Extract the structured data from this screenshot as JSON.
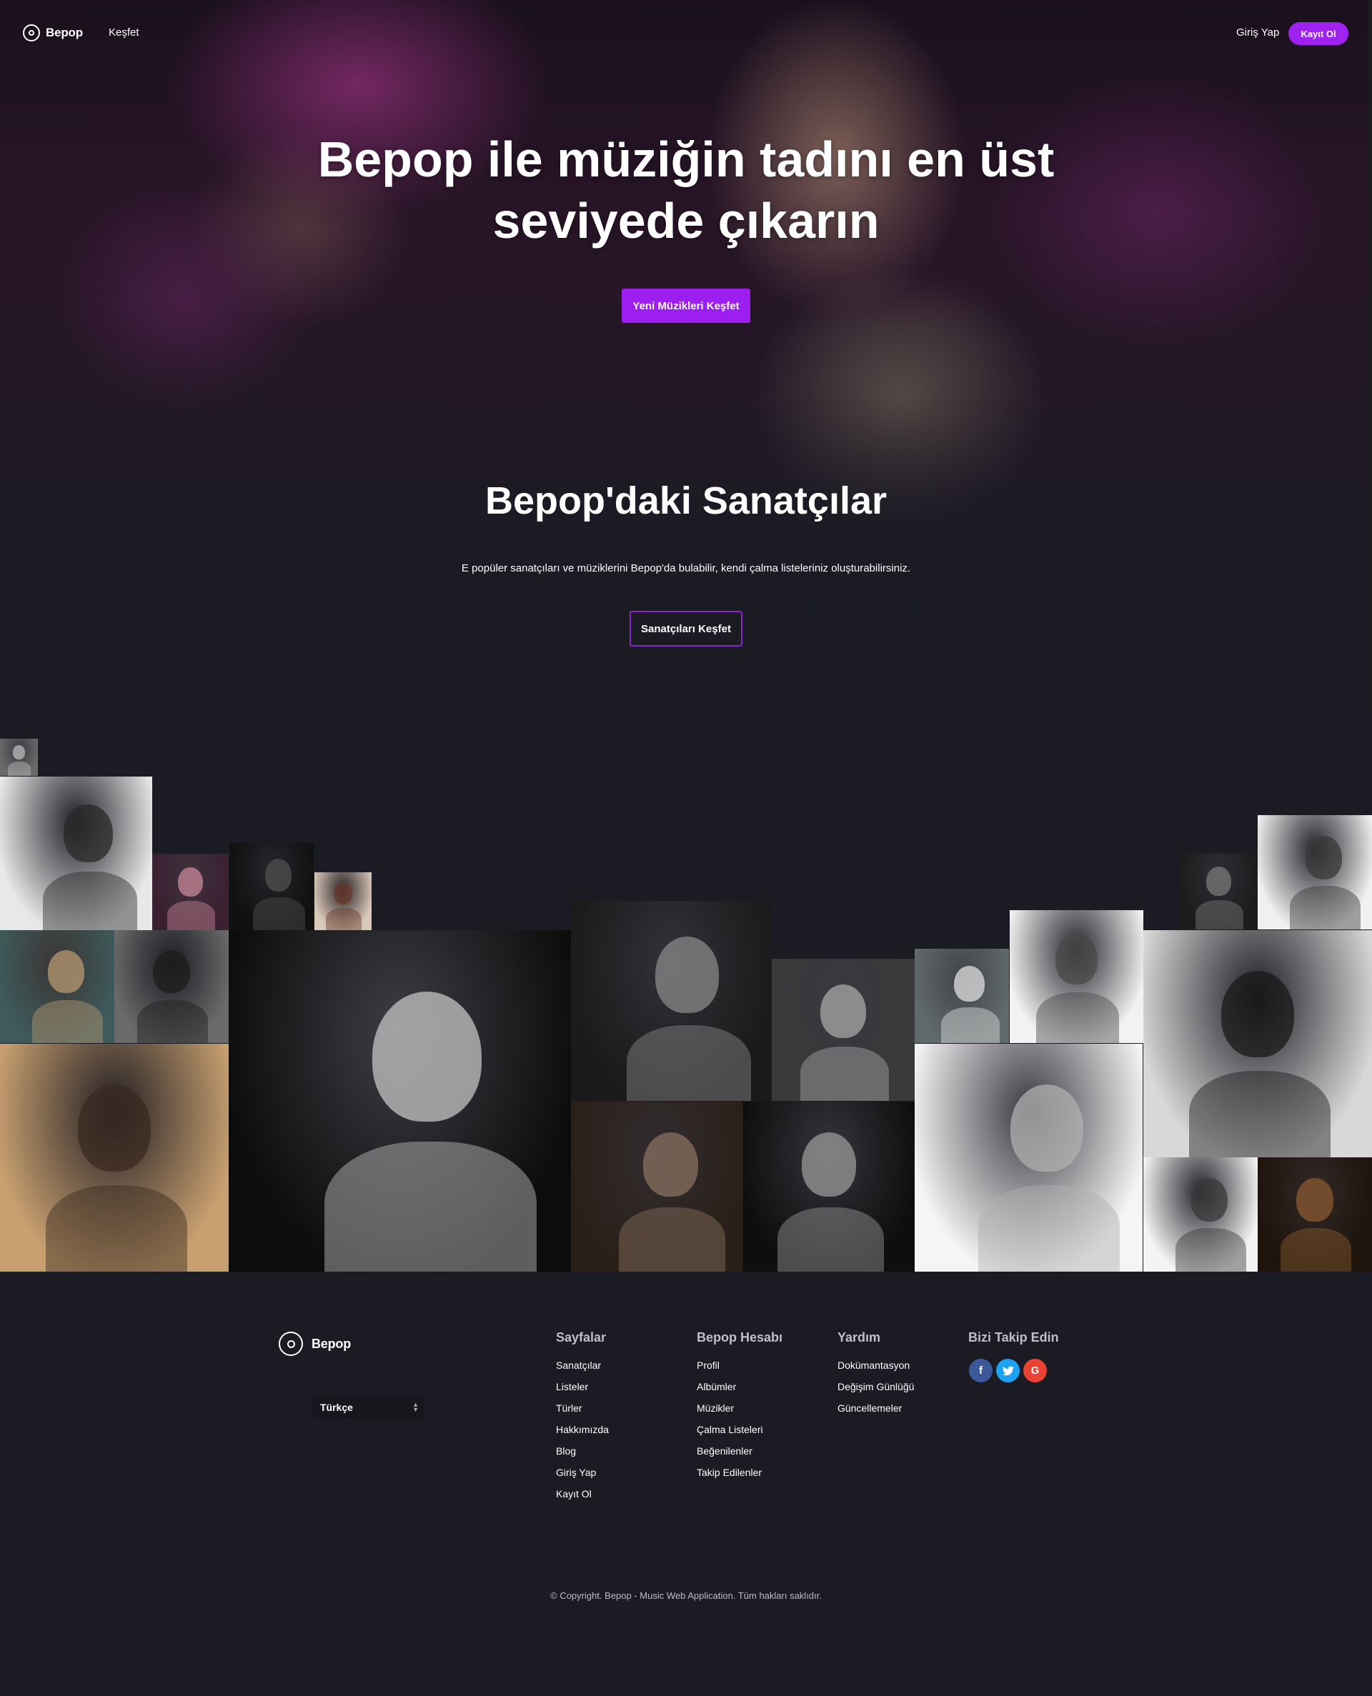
{
  "nav": {
    "brand": "Bepop",
    "explore": "Keşfet",
    "login": "Giriş Yap",
    "signup": "Kayıt Ol"
  },
  "hero": {
    "title": "Bepop ile müziğin tadını en üst seviyede çıkarın",
    "cta": "Yeni Müzikleri Keşfet"
  },
  "artists": {
    "title": "Bepop'daki Sanatçılar",
    "subtitle": "E popüler sanatçıları ve müziklerini Bepop'da bulabilir, kendi çalma listeleriniz oluşturabilirsiniz.",
    "cta": "Sanatçıları Keşfet"
  },
  "footer": {
    "brand": "Bepop",
    "language": "Türkçe",
    "columns": [
      {
        "title": "Sayfalar",
        "links": [
          "Sanatçılar",
          "Listeler",
          "Türler",
          "Hakkımızda",
          "Blog",
          "Giriş Yap",
          "Kayıt Ol"
        ]
      },
      {
        "title": "Bepop Hesabı",
        "links": [
          "Profil",
          "Albümler",
          "Müzikler",
          "Çalma Listeleri",
          "Beğenilenler",
          "Takip Edilenler"
        ]
      },
      {
        "title": "Yardım",
        "links": [
          "Dokümantasyon",
          "Değişim Günlüğü",
          "Güncellemeler"
        ]
      }
    ],
    "follow_title": "Bizi Takip Edin",
    "social": [
      {
        "name": "facebook",
        "glyph": "f",
        "color": "#3b5998"
      },
      {
        "name": "twitter",
        "glyph": "t",
        "color": "#1da1f2"
      },
      {
        "name": "google",
        "glyph": "G",
        "color": "#ea4335"
      }
    ],
    "copyright": "© Copyright. Bepop - Music Web Application. Tüm hakları saklıdır."
  },
  "colors": {
    "accent": "#9c1ff0",
    "background": "#1b1b24"
  }
}
